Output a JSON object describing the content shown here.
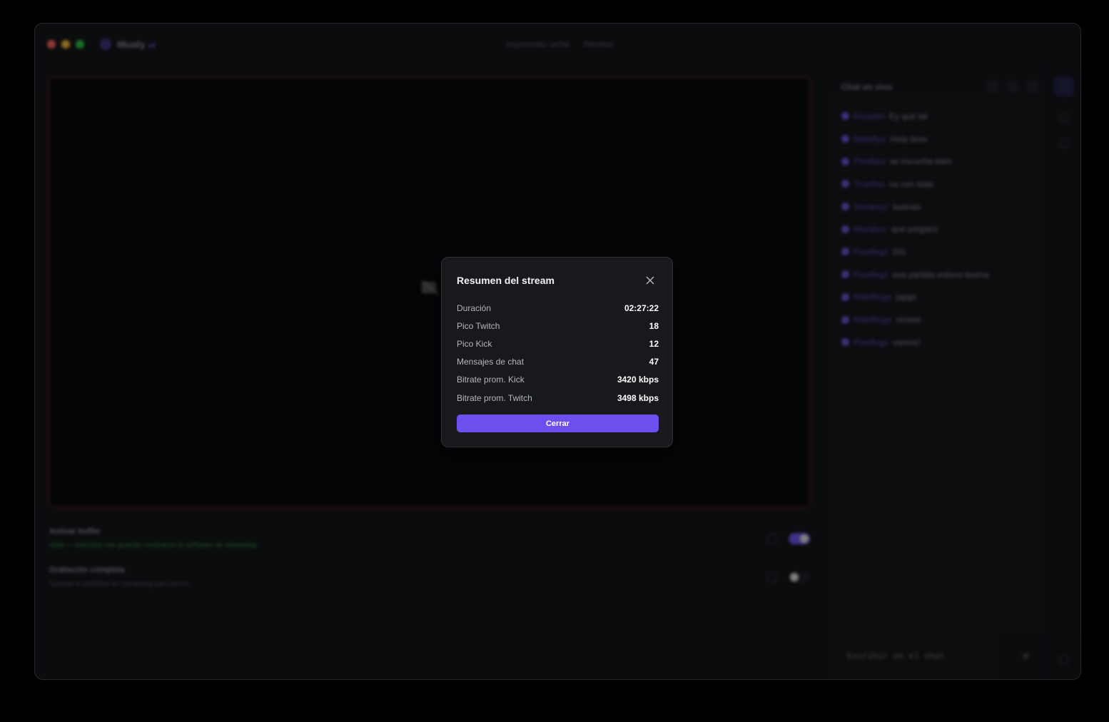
{
  "app": {
    "name": "Mualy",
    "badge": "v4",
    "status_text": "esperando señal",
    "status_link": "Reintan"
  },
  "settings": {
    "buffer_label": "Activar buffer",
    "buffer_desc": "Hola — mientras vas guardar mostraron tu software de streaming",
    "record_label": "Grabación completa",
    "record_desc": "Guarda la totalidad de streaming para proxe"
  },
  "chat": {
    "header": "Chat en vivo",
    "input_placeholder": "Escribir en el chat",
    "messages": [
      {
        "user": "Kloudeh",
        "text": "Ey qué tal"
      },
      {
        "user": "NateByz",
        "text": "Hola broo"
      },
      {
        "user": "Pixelbzz",
        "text": "se escucha bien"
      },
      {
        "user": "Truefino",
        "text": "va con toda"
      },
      {
        "user": "Smokeyz",
        "text": "buenas"
      },
      {
        "user": "Mandurz",
        "text": "qué juegazo"
      },
      {
        "user": "Pixelfegs",
        "text": "GG"
      },
      {
        "user": "Pixelfegs",
        "text": "esa partida estuvo buena"
      },
      {
        "user": "NateRugs",
        "text": "jajaja"
      },
      {
        "user": "NateRugs",
        "text": "niceee"
      },
      {
        "user": "Pixelfugs",
        "text": "vamos!"
      }
    ]
  },
  "modal": {
    "title": "Resumen del stream",
    "close_label": "Cerrar",
    "stats": [
      {
        "label": "Duración",
        "value": "02:27:22"
      },
      {
        "label": "Pico Twitch",
        "value": "18"
      },
      {
        "label": "Pico Kick",
        "value": "12"
      },
      {
        "label": "Mensajes de chat",
        "value": "47"
      },
      {
        "label": "Bitrate prom. Kick",
        "value": "3420 kbps"
      },
      {
        "label": "Bitrate prom. Twitch",
        "value": "3498 kbps"
      }
    ]
  },
  "colors": {
    "accent": "#6d4ff0",
    "modal_bg": "#18191c",
    "window_bg": "#0b0c0e"
  }
}
